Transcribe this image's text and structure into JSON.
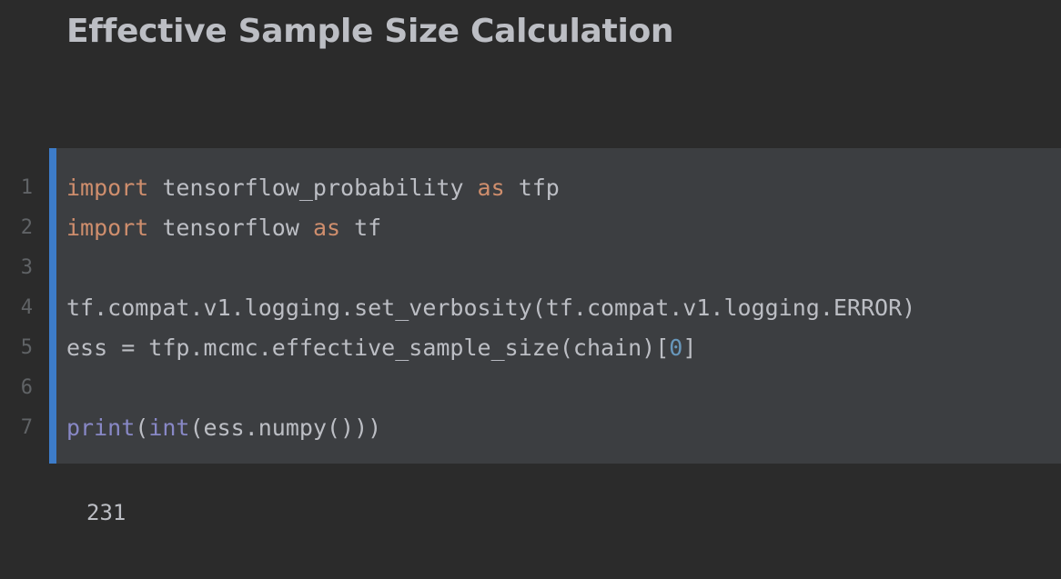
{
  "notebook": {
    "heading": "Effective Sample Size Calculation",
    "cell": {
      "line_numbers": [
        "1",
        "2",
        "3",
        "4",
        "5",
        "6",
        "7"
      ],
      "lines": [
        [
          "import",
          " tensorflow_probability ",
          "as",
          " tfp"
        ],
        [
          "import",
          " tensorflow ",
          "as",
          " tf"
        ],
        [
          ""
        ],
        [
          "tf.compat.v1.logging.set_verbosity(tf.compat.v1.logging.ERROR)"
        ],
        [
          "ess = tfp.mcmc.effective_sample_size(chain)[",
          "0",
          "]"
        ],
        [
          ""
        ],
        [
          "print",
          "(",
          "int",
          "(ess.numpy()))"
        ]
      ]
    },
    "output": "231"
  },
  "colors": {
    "background": "#2b2b2b",
    "cell_background": "#3c3e41",
    "cell_marker": "#3d7cc9",
    "keyword": "#cf8e6d",
    "builtin": "#8888c6",
    "number": "#6897bb",
    "text": "#bcbec4",
    "line_number": "#606366"
  }
}
